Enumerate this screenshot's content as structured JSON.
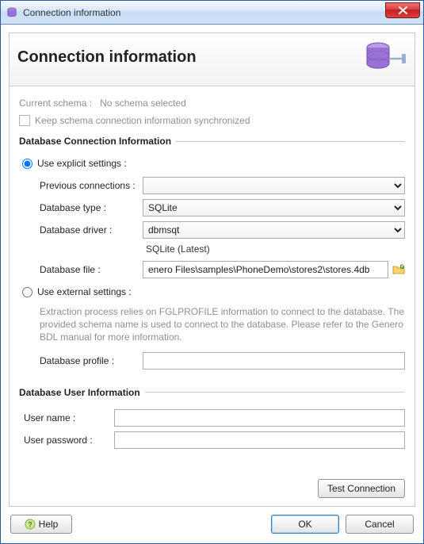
{
  "titlebar": {
    "title": "Connection information"
  },
  "header": {
    "title": "Connection information"
  },
  "schema": {
    "label": "Current schema :",
    "value": "No schema selected",
    "keep_sync_label": "Keep schema connection information synchronized"
  },
  "conn": {
    "legend": "Database Connection Information",
    "explicit_label": "Use explicit settings :",
    "previous_label": "Previous connections :",
    "previous_value": "",
    "type_label": "Database type :",
    "type_value": "SQLite",
    "driver_label": "Database driver :",
    "driver_value": "dbmsqt",
    "driver_note": "SQLite (Latest)",
    "file_label": "Database file :",
    "file_value": "enero Files\\samples\\PhoneDemo\\stores2\\stores.4db",
    "external_label": "Use external settings :",
    "external_note": "Extraction process relies on FGLPROFILE information to connect to the database. The provided schema name is used to connect to the database. Please refer to the Genero BDL manual for more information.",
    "profile_label": "Database profile :",
    "profile_value": ""
  },
  "user": {
    "legend": "Database User Information",
    "name_label": "User name :",
    "name_value": "",
    "password_label": "User password :",
    "password_value": ""
  },
  "buttons": {
    "test": "Test Connection",
    "help": "Help",
    "ok": "OK",
    "cancel": "Cancel"
  }
}
